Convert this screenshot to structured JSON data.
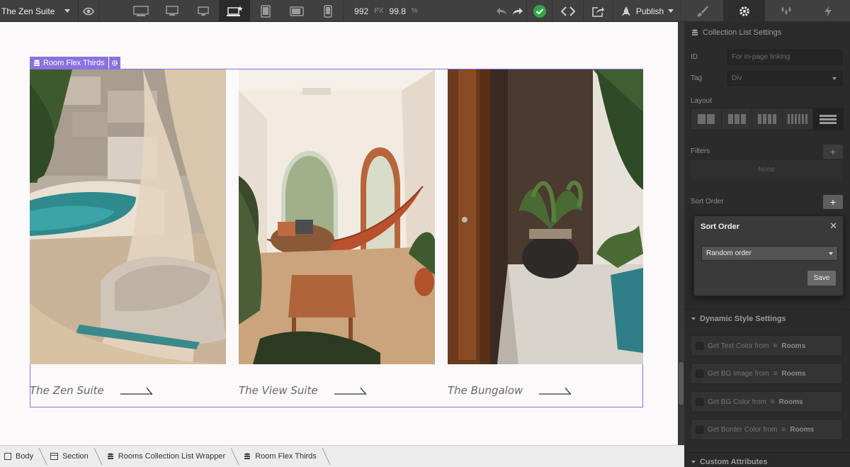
{
  "topbar": {
    "site_name": "The Zen Suite",
    "device_icons": [
      "desktop-large-icon",
      "desktop-icon",
      "desktop-small-icon",
      "laptop-star-icon",
      "tablet-icon",
      "tablet-landscape-icon",
      "phone-icon"
    ],
    "width_value": "992",
    "width_unit": "PX",
    "zoom_value": "99.8",
    "zoom_unit": "%",
    "publish_label": "Publish",
    "status_color": "#2ea64a",
    "panel_tabs": [
      "style-brush-icon",
      "settings-gear-icon",
      "interactions-icon",
      "lightning-icon"
    ]
  },
  "canvas": {
    "selection_label": "Room Flex Thirds",
    "accent": "#8a72e0",
    "cards": [
      {
        "title": "The Zen Suite"
      },
      {
        "title": "The View Suite"
      },
      {
        "title": "The Bungalow"
      }
    ]
  },
  "breadcrumb": [
    {
      "icon": "body-icon",
      "label": "Body"
    },
    {
      "icon": "section-icon",
      "label": "Section"
    },
    {
      "icon": "collection-icon",
      "label": "Rooms Collection List Wrapper"
    },
    {
      "icon": "collection-icon",
      "label": "Room Flex Thirds"
    }
  ],
  "panel": {
    "title": "Collection List Settings",
    "id_label": "ID",
    "id_placeholder": "For in-page linking",
    "tag_label": "Tag",
    "tag_value": "Div",
    "layout_label": "Layout",
    "filters_label": "Filters",
    "filters_value": "None",
    "sort_label": "Sort Order",
    "popover": {
      "title": "Sort Order",
      "select_value": "Random order",
      "save_label": "Save"
    },
    "dynamic_title": "Dynamic Style Settings",
    "dynamic_items": [
      {
        "label": "Get Text Color from",
        "source": "Rooms"
      },
      {
        "label": "Get BG Image from",
        "source": "Rooms"
      },
      {
        "label": "Get BG Color from",
        "source": "Rooms"
      },
      {
        "label": "Get Border Color from",
        "source": "Rooms"
      }
    ],
    "custom_title": "Custom Attributes"
  }
}
